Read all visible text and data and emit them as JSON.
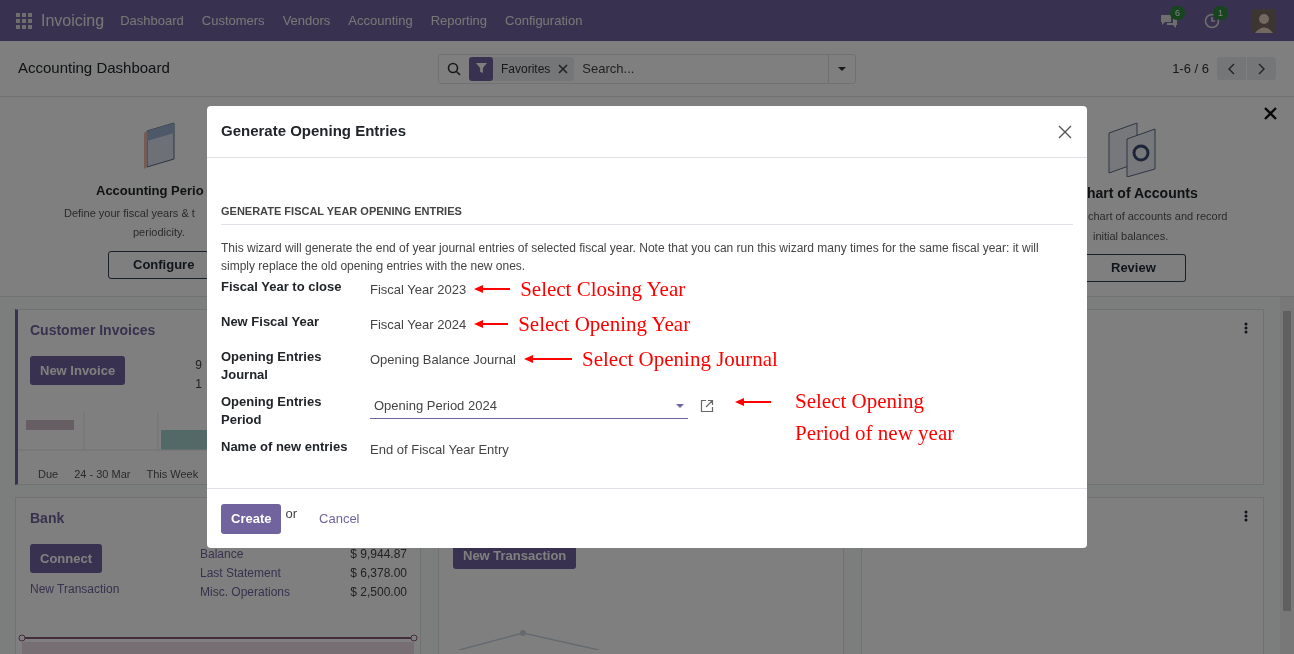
{
  "navbar": {
    "app": "Invoicing",
    "menu": [
      "Dashboard",
      "Customers",
      "Vendors",
      "Accounting",
      "Reporting",
      "Configuration"
    ],
    "messages_count": "6",
    "activities_count": "1"
  },
  "control_panel": {
    "title": "Accounting Dashboard",
    "search": {
      "facet": "Favorites",
      "placeholder": "Search..."
    },
    "pager": "1-6 / 6"
  },
  "onboarding": {
    "steps": [
      {
        "title": "Accounting Perio",
        "description": [
          "Define your fiscal years & t",
          "periodicity."
        ],
        "button": "Configure"
      },
      {
        "title": "hart of Accounts",
        "description": [
          "chart of accounts and record",
          "initial balances."
        ],
        "button": "Review"
      }
    ]
  },
  "cards": {
    "customer_invoices": {
      "title": "Customer Invoices",
      "button": "New Invoice",
      "figures": [
        "9",
        "1"
      ],
      "chart_labels": [
        "Due",
        "24 - 30 Mar",
        "This Week"
      ]
    },
    "bank": {
      "title": "Bank",
      "button": "Connect",
      "link": "New Transaction",
      "stats": [
        {
          "label": "Balance",
          "value": "$ 9,944.87"
        },
        {
          "label": "Last Statement",
          "value": "$ 6,378.00"
        },
        {
          "label": "Misc. Operations",
          "value": "$ 2,500.00"
        }
      ]
    },
    "cash": {
      "button": "New Transaction"
    }
  },
  "dialog": {
    "title": "Generate Opening Entries",
    "section": "GENERATE FISCAL YEAR OPENING ENTRIES",
    "intro": "This wizard will generate the end of year journal entries of selected fiscal year. Note that you can run this wizard many times for the same fiscal year: it will simply replace the old opening entries with the new ones.",
    "fields": [
      {
        "kind": "text",
        "label": "Fiscal Year to close",
        "value": "Fiscal Year 2023",
        "annotation": "Select Closing Year"
      },
      {
        "kind": "text",
        "label": "New Fiscal Year",
        "value": "Fiscal Year 2024",
        "annotation": "Select Opening Year"
      },
      {
        "kind": "text",
        "label": "Opening Entries Journal",
        "value": "Opening Balance Journal",
        "annotation": "Select Opening Journal"
      },
      {
        "kind": "select",
        "label": "Opening Entries Period",
        "value": "Opening Period 2024",
        "annotation": "Select Opening Period of new year"
      },
      {
        "kind": "text",
        "label": "Name of new entries",
        "value": "End of Fiscal Year Entry"
      }
    ],
    "primary_button": "Create",
    "separator": "or",
    "cancel": "Cancel"
  }
}
